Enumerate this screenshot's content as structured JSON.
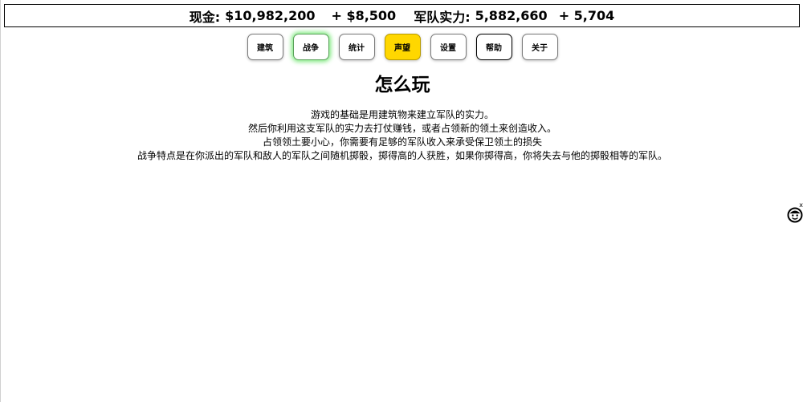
{
  "topbar": {
    "money_label": "现金:",
    "money_value": "$10,982,200",
    "money_income": "+ $8,500",
    "army_label": "军队实力:",
    "army_value": "5,882,660",
    "army_income": "+ 5,704"
  },
  "nav": {
    "buttons": [
      {
        "label": "建筑",
        "state": "normal"
      },
      {
        "label": "战争",
        "state": "highlight-green"
      },
      {
        "label": "统计",
        "state": "normal"
      },
      {
        "label": "声望",
        "state": "active-yellow"
      },
      {
        "label": "设置",
        "state": "normal"
      },
      {
        "label": "帮助",
        "state": "dark-border"
      },
      {
        "label": "关于",
        "state": "normal"
      }
    ]
  },
  "help": {
    "title": "怎么玩",
    "lines": [
      "游戏的基础是用建筑物来建立军队的实力。",
      "然后你利用这支军队的实力去打仗赚钱，或者占领新的领土来创造收入。",
      "占领领土要小心，你需要有足够的军队收入来承受保卫领土的损失",
      "战争特点是在你派出的军队和敌人的军队之间随机掷骰，掷得高的人获胜，如果你掷得高，你将失去与他的掷骰相等的军队。"
    ]
  },
  "widget": {
    "close_label": "x",
    "icon": "helper-face-icon"
  },
  "colors": {
    "active_yellow": "#ffd700",
    "glow_green": "#7be87b"
  }
}
